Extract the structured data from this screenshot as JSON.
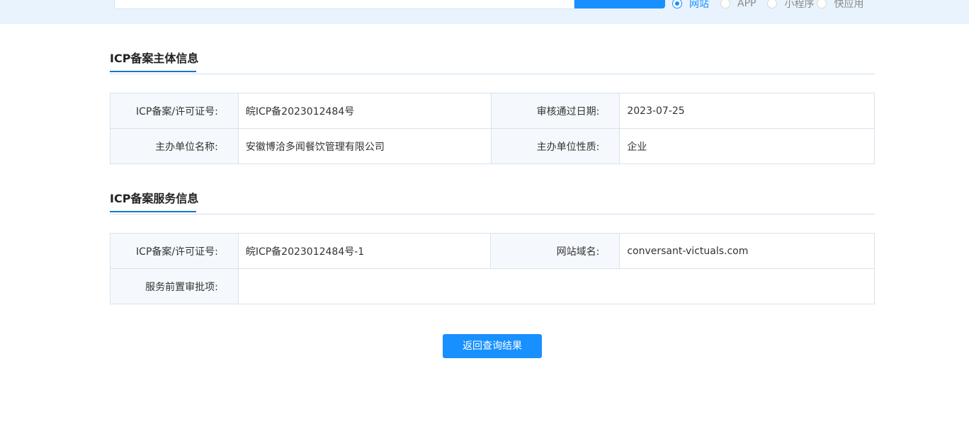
{
  "search": {
    "placeholder": "",
    "types": [
      {
        "label": "网站",
        "selected": true
      },
      {
        "label": "APP",
        "selected": false
      },
      {
        "label": "小程序",
        "selected": false
      },
      {
        "label": "快应用",
        "selected": false
      }
    ]
  },
  "subject": {
    "title": "ICP备案主体信息",
    "rows": [
      {
        "k1": "ICP备案/许可证号:",
        "v1": "皖ICP备2023012484号",
        "k2": "审核通过日期:",
        "v2": "2023-07-25"
      },
      {
        "k1": "主办单位名称:",
        "v1": "安徽博洽多闻餐饮管理有限公司",
        "k2": "主办单位性质:",
        "v2": "企业"
      }
    ]
  },
  "service": {
    "title": "ICP备案服务信息",
    "rows": [
      {
        "k1": "ICP备案/许可证号:",
        "v1": "皖ICP备2023012484号-1",
        "k2": "网站域名:",
        "v2": "conversant-victuals.com"
      },
      {
        "k1": "服务前置审批项:",
        "v1": ""
      }
    ]
  },
  "actions": {
    "back_label": "返回查询结果"
  },
  "colors": {
    "accent": "#1890ff",
    "band": "#e8f3fd",
    "key_bg": "#f5f9fd"
  }
}
